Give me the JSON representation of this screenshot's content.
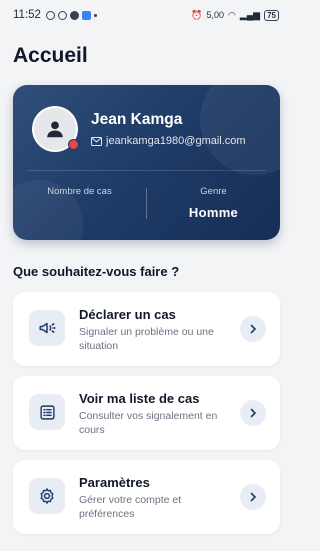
{
  "status_bar": {
    "time": "11:52",
    "data_rate": "5,00",
    "battery": "75"
  },
  "page": {
    "title": "Accueil"
  },
  "profile": {
    "name": "Jean Kamga",
    "email": "jeankamga1980@gmail.com",
    "stats": [
      {
        "label": "Nombre de cas",
        "value": ""
      },
      {
        "label": "Genre",
        "value": "Homme"
      }
    ]
  },
  "section": {
    "title": "Que souhaitez-vous faire ?"
  },
  "actions": [
    {
      "title": "Déclarer un cas",
      "description": "Signaler un problème ou une situation",
      "icon": "megaphone-icon"
    },
    {
      "title": "Voir ma liste de cas",
      "description": "Consulter vos signalement en cours",
      "icon": "list-icon"
    },
    {
      "title": "Paramètres",
      "description": "Gérer votre compte et préférences",
      "icon": "gear-icon"
    }
  ],
  "colors": {
    "card_gradient_start": "#2f4f7a",
    "card_gradient_end": "#162f57",
    "accent": "#1e3a66",
    "status_dot": "#ef4444"
  }
}
